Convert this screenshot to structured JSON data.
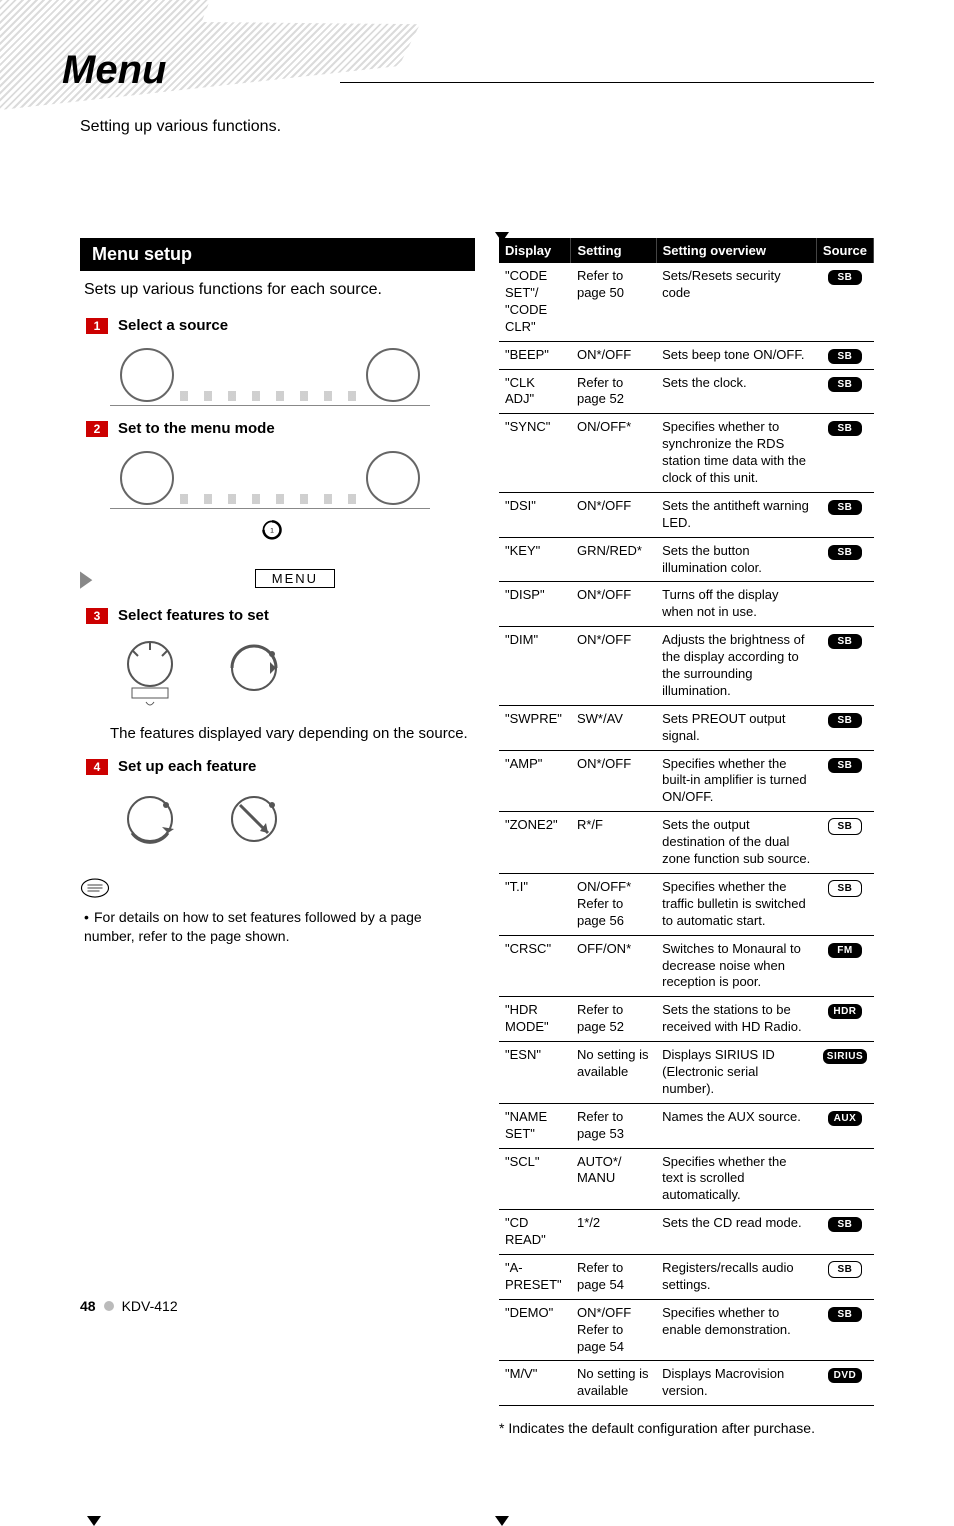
{
  "header": {
    "title": "Menu",
    "subtitle": "Setting up various functions."
  },
  "left": {
    "section_heading": "Menu setup",
    "lead": "Sets up various functions for each source.",
    "steps": [
      {
        "num": "1",
        "label": "Select a source"
      },
      {
        "num": "2",
        "label": "Set to the menu mode"
      },
      {
        "num": "3",
        "label": "Select features to set"
      },
      {
        "num": "4",
        "label": "Set up each feature"
      }
    ],
    "menu_tag": "MENU",
    "post_step3": "The features displayed vary depending on the source.",
    "note": "For details on how to set features followed by a page number, refer to the page shown."
  },
  "table": {
    "headers": [
      "Display",
      "Setting",
      "Setting overview",
      "Source"
    ],
    "rows": [
      {
        "display": "\"CODE SET\"/\n\"CODE CLR\"",
        "setting": "Refer to page 50",
        "overview": "Sets/Resets security code",
        "badge": "SB",
        "style": "solid"
      },
      {
        "display": "\"BEEP\"",
        "setting": "ON*/OFF",
        "overview": "Sets beep tone ON/OFF.",
        "badge": "SB",
        "style": "solid"
      },
      {
        "display": "\"CLK ADJ\"",
        "setting": "Refer to page 52",
        "overview": "Sets the clock.",
        "badge": "SB",
        "style": "solid"
      },
      {
        "display": "\"SYNC\"",
        "setting": "ON/OFF*",
        "overview": "Specifies whether to synchronize the RDS station time data with the clock of this unit.",
        "badge": "SB",
        "style": "solid"
      },
      {
        "display": "\"DSI\"",
        "setting": "ON*/OFF",
        "overview": "Sets the antitheft warning LED.",
        "badge": "SB",
        "style": "solid"
      },
      {
        "display": "\"KEY\"",
        "setting": "GRN/RED*",
        "overview": "Sets the button illumination color.",
        "badge": "SB",
        "style": "solid"
      },
      {
        "display": "\"DISP\"",
        "setting": "ON*/OFF",
        "overview": "Turns off the display when not in use.",
        "badge": "",
        "style": ""
      },
      {
        "display": "\"DIM\"",
        "setting": "ON*/OFF",
        "overview": "Adjusts the brightness of the display according to the surrounding illumination.",
        "badge": "SB",
        "style": "solid"
      },
      {
        "display": "\"SWPRE\"",
        "setting": "SW*/AV",
        "overview": "Sets PREOUT output signal.",
        "badge": "SB",
        "style": "solid"
      },
      {
        "display": "\"AMP\"",
        "setting": "ON*/OFF",
        "overview": "Specifies whether the built-in amplifier is turned ON/OFF.",
        "badge": "SB",
        "style": "solid"
      },
      {
        "display": "\"ZONE2\"",
        "setting": "R*/F",
        "overview": "Sets the output destination of the dual zone function sub source.",
        "badge": "SB",
        "style": "outline"
      },
      {
        "display": "\"T.I\"",
        "setting": "ON/OFF*\nRefer to page 56",
        "overview": "Specifies whether the traffic bulletin is switched to automatic start.",
        "badge": "SB",
        "style": "outline"
      },
      {
        "display": "\"CRSC\"",
        "setting": "OFF/ON*",
        "overview": "Switches to Monaural to decrease noise when reception is poor.",
        "badge": "FM",
        "style": "solid"
      },
      {
        "display": "\"HDR MODE\"",
        "setting": "Refer to page 52",
        "overview": "Sets the stations to be received with HD Radio.",
        "badge": "HDR",
        "style": "solid"
      },
      {
        "display": "\"ESN\"",
        "setting": "No setting is available",
        "overview": "Displays SIRIUS ID (Electronic serial number).",
        "badge": "SIRIUS",
        "style": "solid"
      },
      {
        "display": "\"NAME SET\"",
        "setting": "Refer to page 53",
        "overview": "Names the AUX source.",
        "badge": "AUX",
        "style": "solid"
      },
      {
        "display": "\"SCL\"",
        "setting": "AUTO*/\nMANU",
        "overview": "Specifies whether the text is scrolled automatically.",
        "badge": "",
        "style": ""
      },
      {
        "display": "\"CD READ\"",
        "setting": "1*/2",
        "overview": "Sets the CD read mode.",
        "badge": "SB",
        "style": "solid"
      },
      {
        "display": "\"A-\nPRESET\"",
        "setting": "Refer to page 54",
        "overview": "Registers/recalls audio settings.",
        "badge": "SB",
        "style": "outline"
      },
      {
        "display": "\"DEMO\"",
        "setting": "ON*/OFF\nRefer to page 54",
        "overview": "Specifies whether to enable demonstration.",
        "badge": "SB",
        "style": "solid"
      },
      {
        "display": "\"M/V\"",
        "setting": "No setting is available",
        "overview": "Displays Macrovision version.",
        "badge": "DVD",
        "style": "solid"
      }
    ],
    "footnote": "* Indicates the default configuration after purchase."
  },
  "footer": {
    "page": "48",
    "model": "KDV-412"
  }
}
